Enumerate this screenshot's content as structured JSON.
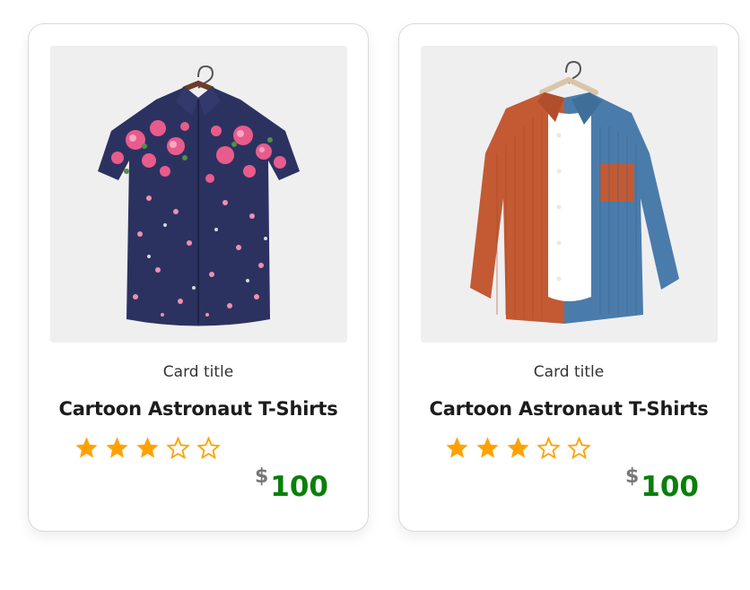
{
  "products": [
    {
      "card_title": "Card title",
      "name": "Cartoon Astronaut T-Shirts",
      "image": "floral-print-navy-shirt",
      "rating": 3,
      "rating_max": 5,
      "currency": "$",
      "price": "100"
    },
    {
      "card_title": "Card title",
      "name": "Cartoon Astronaut T-Shirts",
      "image": "orange-blue-corduroy-shirt",
      "rating": 3,
      "rating_max": 5,
      "currency": "$",
      "price": "100"
    }
  ],
  "colors": {
    "star": "#ffa200",
    "price": "#0a7f0a",
    "currency": "#777777"
  }
}
